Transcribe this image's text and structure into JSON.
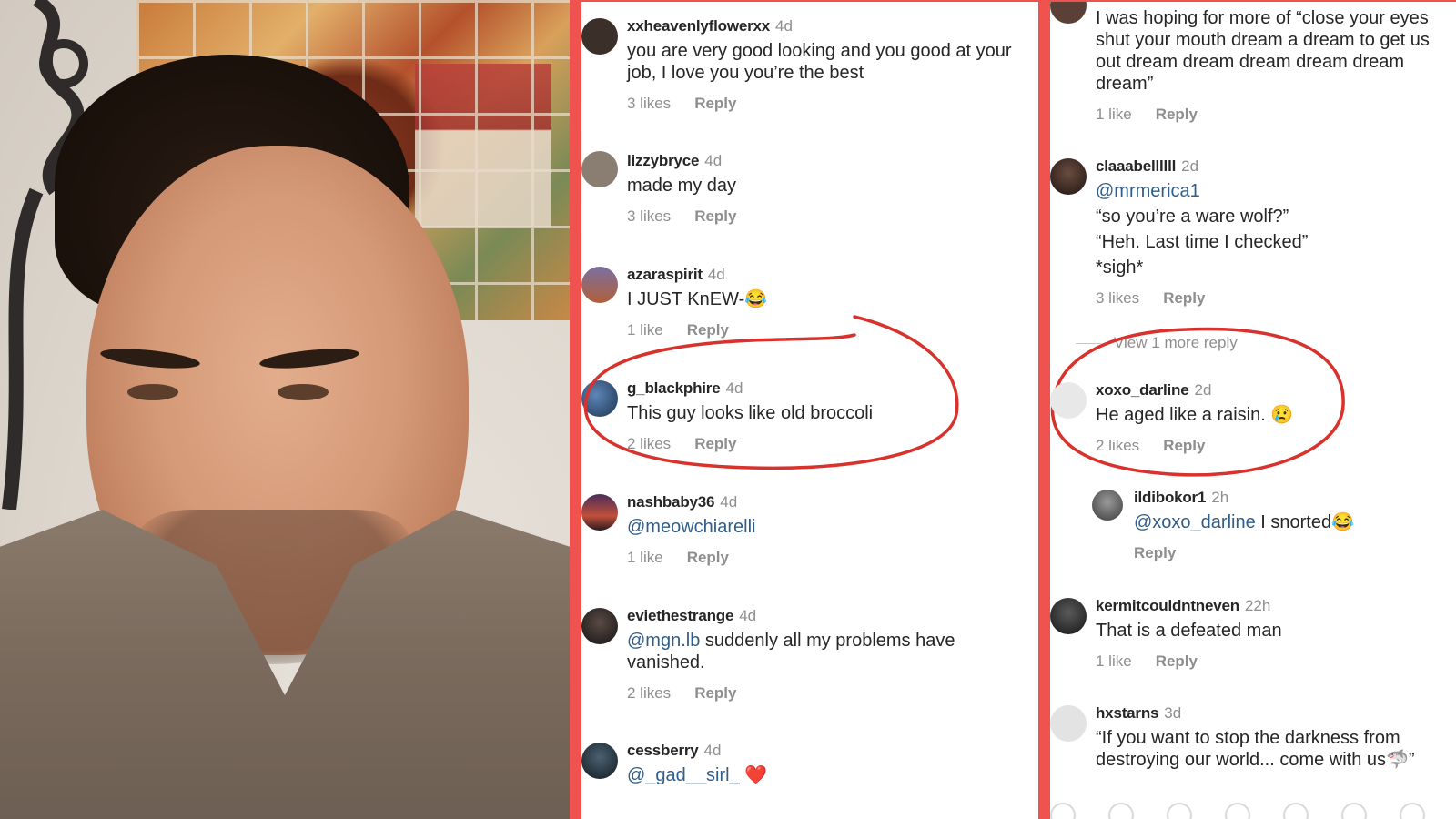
{
  "colors": {
    "frame_red": "#f0524f",
    "mention_blue": "#2f5d8a",
    "muted_gray": "#8e8e8e",
    "text_dark": "#262626"
  },
  "video": {
    "description_icon": "person-video-frame"
  },
  "middle_comments": [
    {
      "user": "xxheavenlyflowerxx",
      "time": "4d",
      "text": "you are very good looking and you good at your job, I love you you’re the best",
      "mention": "",
      "likes": "3 likes",
      "reply": "Reply",
      "avatar_color": "#3b2f2a"
    },
    {
      "user": "lizzybryce",
      "time": "4d",
      "text": "made my day",
      "mention": "",
      "likes": "3 likes",
      "reply": "Reply",
      "avatar_color": "#7a6d62"
    },
    {
      "user": "azaraspirit",
      "time": "4d",
      "text": "I JUST KnEW-😂",
      "mention": "",
      "likes": "1 like",
      "reply": "Reply",
      "avatar_color": "#b05a3a"
    },
    {
      "user": "g_blackphire",
      "time": "4d",
      "text": "This guy looks like old broccoli",
      "mention": "",
      "likes": "2 likes",
      "reply": "Reply",
      "avatar_color": "#2a4a6e"
    },
    {
      "user": "nashbaby36",
      "time": "4d",
      "text": "",
      "mention": "@meowchiarelli",
      "likes": "1 like",
      "reply": "Reply",
      "avatar_color": "#c0503a"
    },
    {
      "user": "eviethestrange",
      "time": "4d",
      "text": "suddenly all my problems have vanished.",
      "mention": "@mgn.lb",
      "likes": "2 likes",
      "reply": "Reply",
      "avatar_color": "#2b2b2b"
    },
    {
      "user": "cessberry",
      "time": "4d",
      "text": "",
      "mention": "@_gad__sirl_",
      "heart": "❤️",
      "likes": "",
      "reply": "",
      "avatar_color": "#1f3340"
    }
  ],
  "right_comments": [
    {
      "user": "",
      "time": "",
      "text": "I was hoping for more of “close your eyes shut your mouth dream a dream to get us out dream dream dream dream dream dream”",
      "likes": "1 like",
      "reply": "Reply"
    },
    {
      "user": "claaabellllll",
      "time": "2d",
      "mention": "@mrmerica1",
      "lines": [
        "“so you’re a ware wolf?”",
        "“Heh. Last time I checked”",
        "*sigh*"
      ],
      "likes": "3 likes",
      "reply": "Reply",
      "avatar_color": "#3a2a24"
    },
    {
      "view_more": "View 1 more reply"
    },
    {
      "user": "xoxo_darline",
      "time": "2d",
      "text": "He aged like a raisin. 😢",
      "likes": "2 likes",
      "reply": "Reply",
      "avatar_color": "#e3e3e3"
    },
    {
      "user": "ildibokor1",
      "time": "2h",
      "mention": "@xoxo_darline",
      "text": " I snorted😂",
      "likes": "",
      "reply": "Reply",
      "avatar_color": "#6b6b6b"
    },
    {
      "user": "kermitcouldntneven",
      "time": "22h",
      "text": "That is a defeated man",
      "likes": "1 like",
      "reply": "Reply",
      "avatar_color": "#2e2e2e"
    },
    {
      "user": "hxstarns",
      "time": "3d",
      "text": "“If you want to stop the darkness from destroying our world... come with us🦈”",
      "likes": "",
      "reply": "",
      "avatar_color": "#dcdcdc"
    }
  ]
}
